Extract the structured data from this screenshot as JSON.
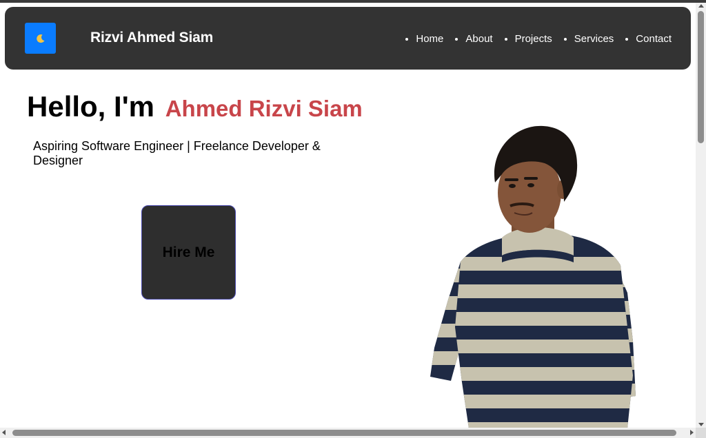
{
  "navbar": {
    "theme_icon": "crescent-moon-icon",
    "brand": "Rizvi Ahmed Siam",
    "items": [
      {
        "label": "Home"
      },
      {
        "label": "About"
      },
      {
        "label": "Projects"
      },
      {
        "label": "Services"
      },
      {
        "label": "Contact"
      }
    ]
  },
  "hero": {
    "greeting": "Hello, I'm",
    "name": "Ahmed Rizvi Siam",
    "tagline": "Aspiring Software Engineer | Freelance Developer & Designer",
    "cta_label": "Hire Me"
  },
  "colors": {
    "navbar_bg": "#333333",
    "theme_button": "#0a7cff",
    "name_accent": "#c8454a",
    "cta_bg": "#2e2e2e"
  }
}
